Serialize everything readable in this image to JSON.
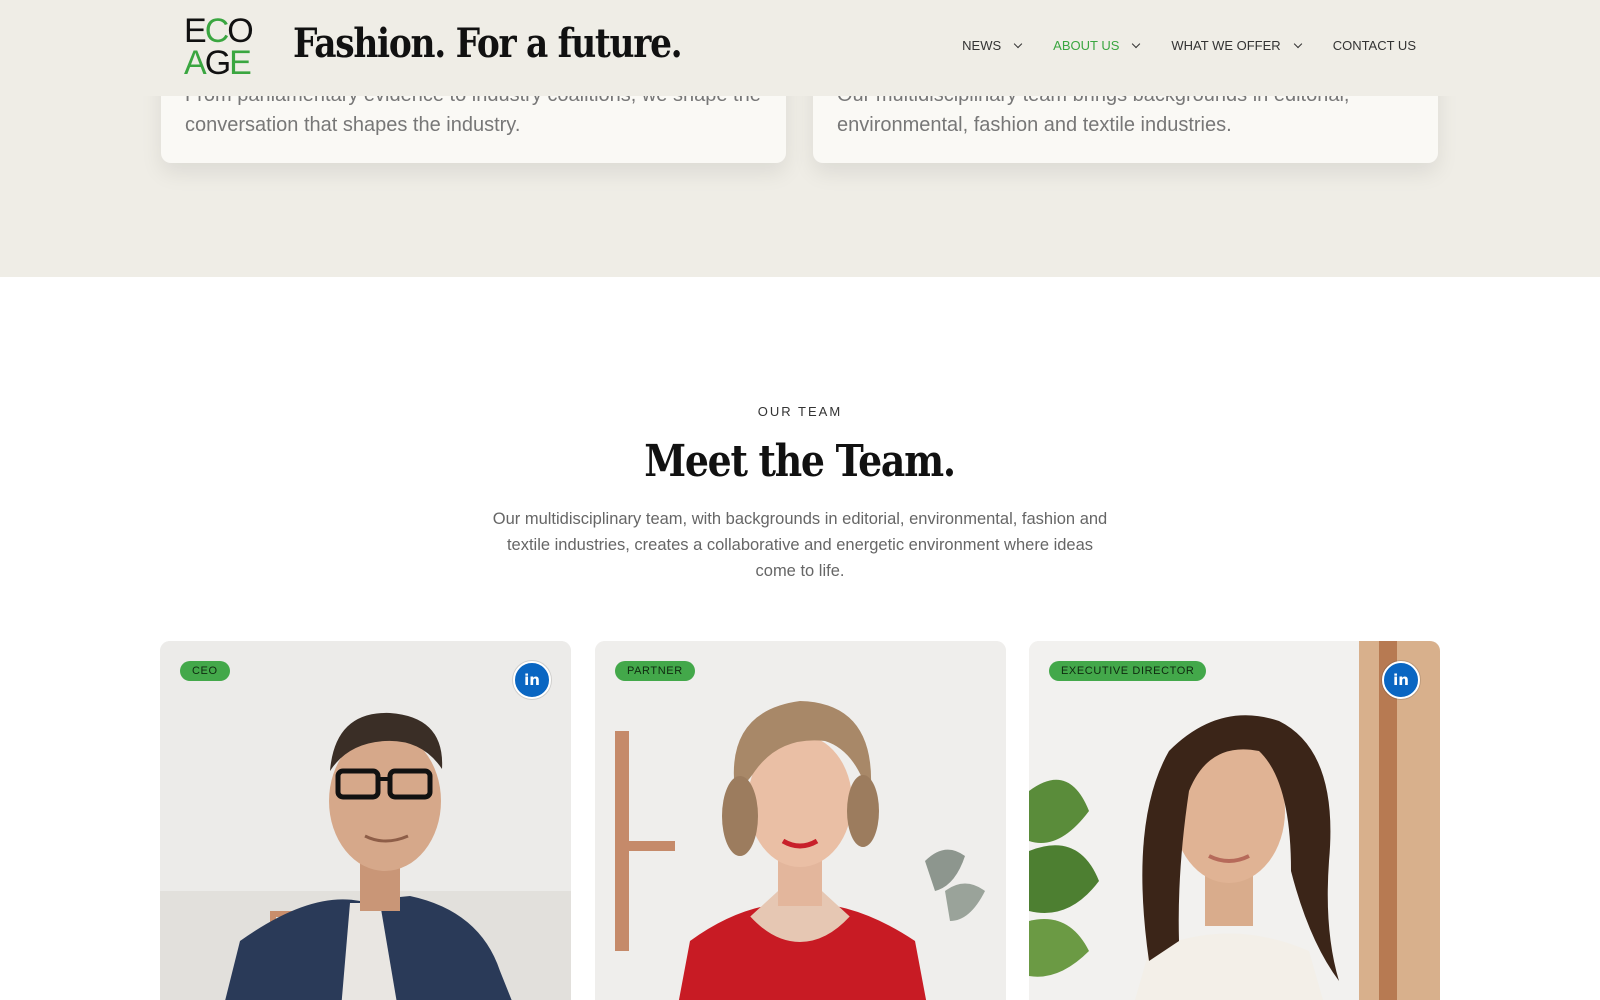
{
  "header": {
    "logo_top": "ECO",
    "logo_bottom": "AGE",
    "tagline": "Fashion. For a future.",
    "nav": [
      {
        "label": "NEWS",
        "has_dropdown": true,
        "active": false
      },
      {
        "label": "ABOUT US",
        "has_dropdown": true,
        "active": true
      },
      {
        "label": "WHAT WE OFFER",
        "has_dropdown": true,
        "active": false
      },
      {
        "label": "CONTACT US",
        "has_dropdown": false,
        "active": false
      }
    ]
  },
  "features": [
    {
      "text": "From parliamentary evidence to industry coalitions, we shape the conversation that shapes the industry."
    },
    {
      "text": "Our multidisciplinary team brings backgrounds in editorial, environmental, fashion and textile industries."
    }
  ],
  "team": {
    "eyebrow": "OUR TEAM",
    "title": "Meet the Team.",
    "description": "Our multidisciplinary team, with backgrounds in editorial, environmental, fashion and textile industries, creates a collaborative and energetic environment where ideas come to life.",
    "members": [
      {
        "role": "CEO",
        "has_linkedin": true,
        "linkedin_label": "in"
      },
      {
        "role": "PARTNER",
        "has_linkedin": false
      },
      {
        "role": "EXECUTIVE DIRECTOR",
        "has_linkedin": true,
        "linkedin_label": "in"
      }
    ]
  },
  "colors": {
    "brand_green": "#3aa640",
    "beige": "#efede6",
    "linkedin_blue": "#0a66c2"
  }
}
